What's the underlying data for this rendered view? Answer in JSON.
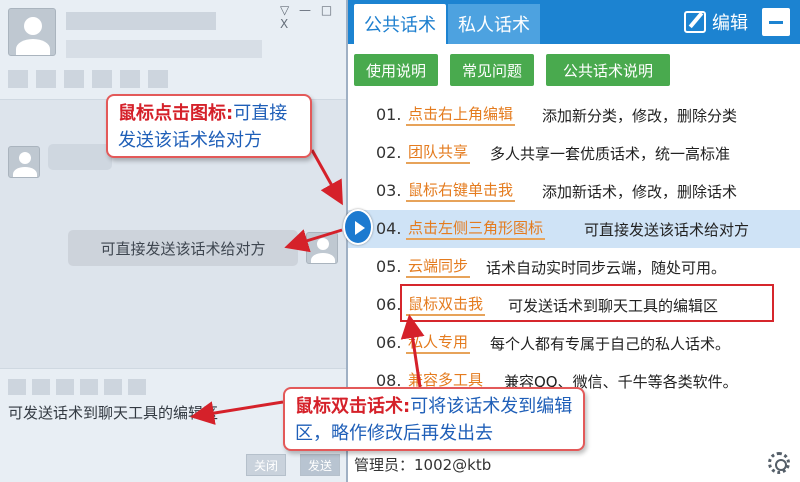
{
  "chat": {
    "window_controls": "▽ — □ X",
    "bubble_text": "可直接发送该话术给对方",
    "input_text": "可发送话术到聊天工具的编辑区",
    "close_label": "关闭",
    "send_label": "发送"
  },
  "panel": {
    "tabs": [
      "公共话术",
      "私人话术"
    ],
    "edit_label": "编辑",
    "buttons": [
      "使用说明",
      "常见问题",
      "公共话术说明"
    ],
    "items": [
      {
        "num": "01.",
        "tag": "点击右上角编辑",
        "desc": "添加新分类，修改，删除分类"
      },
      {
        "num": "02.",
        "tag": "团队共享",
        "desc": "多人共享一套优质话术，统一高标准"
      },
      {
        "num": "03.",
        "tag": "鼠标右键单击我",
        "desc": "添加新话术，修改，删除话术"
      },
      {
        "num": "04.",
        "tag": "点击左侧三角形图标",
        "desc": "可直接发送该话术给对方"
      },
      {
        "num": "05.",
        "tag": "云端同步",
        "desc": "话术自动实时同步云端，随处可用。"
      },
      {
        "num": "06.",
        "tag": "鼠标双击我",
        "desc": "可发送话术到聊天工具的编辑区"
      },
      {
        "num": "06.",
        "tag": "私人专用",
        "desc": "每个人都有专属于自己的私人话术。"
      },
      {
        "num": "08.",
        "tag": "兼容多工具",
        "desc": "兼容QQ、微信、千牛等各类软件。"
      }
    ],
    "footer": "管理员：1002@ktb"
  },
  "annotations": {
    "callout1_red": "鼠标点击图标:",
    "callout1_blue": "可直接发送该话术给对方",
    "callout2_red": "鼠标双击话术:",
    "callout2_blue": "可将该话术发到编辑区，略作修改后再发出去"
  },
  "colors": {
    "accent_blue": "#1c83d1",
    "button_green": "#49aa4e",
    "tag_orange": "#e47b1e",
    "annotation_red": "#d5212a"
  },
  "icons": [
    "avatar-icon",
    "pen-icon",
    "minimize-icon",
    "play-triangle-icon",
    "gear-icon"
  ]
}
